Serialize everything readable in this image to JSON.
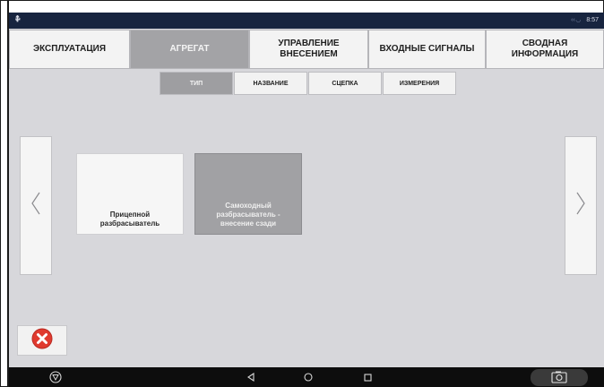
{
  "status_bar": {
    "left_icon": "usb-icon",
    "signal": "‹‹ ◡",
    "time": "8:57"
  },
  "main_tabs": [
    {
      "label": "ЭКСПЛУАТАЦИЯ",
      "active": false
    },
    {
      "label": "АГРЕГАТ",
      "active": true
    },
    {
      "label": "УПРАВЛЕНИЕ ВНЕСЕНИЕМ",
      "active": false
    },
    {
      "label": "ВХОДНЫЕ СИГНАЛЫ",
      "active": false
    },
    {
      "label": "СВОДНАЯ ИНФОРМАЦИЯ",
      "active": false
    }
  ],
  "sub_tabs": [
    {
      "label": "ТИП",
      "active": true
    },
    {
      "label": "НАЗВАНИЕ",
      "active": false
    },
    {
      "label": "СЦЕПКА",
      "active": false
    },
    {
      "label": "ИЗМЕРЕНИЯ",
      "active": false
    }
  ],
  "options": [
    {
      "label": "Прицепной разбрасыватель",
      "selected": false
    },
    {
      "label": "Самоходный разбрасыватель - внесение сзади",
      "selected": true
    }
  ],
  "icons": {
    "prev": "chevron-left-icon",
    "next": "chevron-right-icon",
    "close": "close-red-icon",
    "nav_home_logo": "logo-icon",
    "nav_back": "back-icon",
    "nav_home": "home-icon",
    "nav_recent": "recent-apps-icon",
    "nav_screenshot": "camera-icon"
  },
  "colors": {
    "status_bar": "#17243f",
    "active_tab": "#a3a3a6",
    "close_red": "#e03a2f"
  }
}
